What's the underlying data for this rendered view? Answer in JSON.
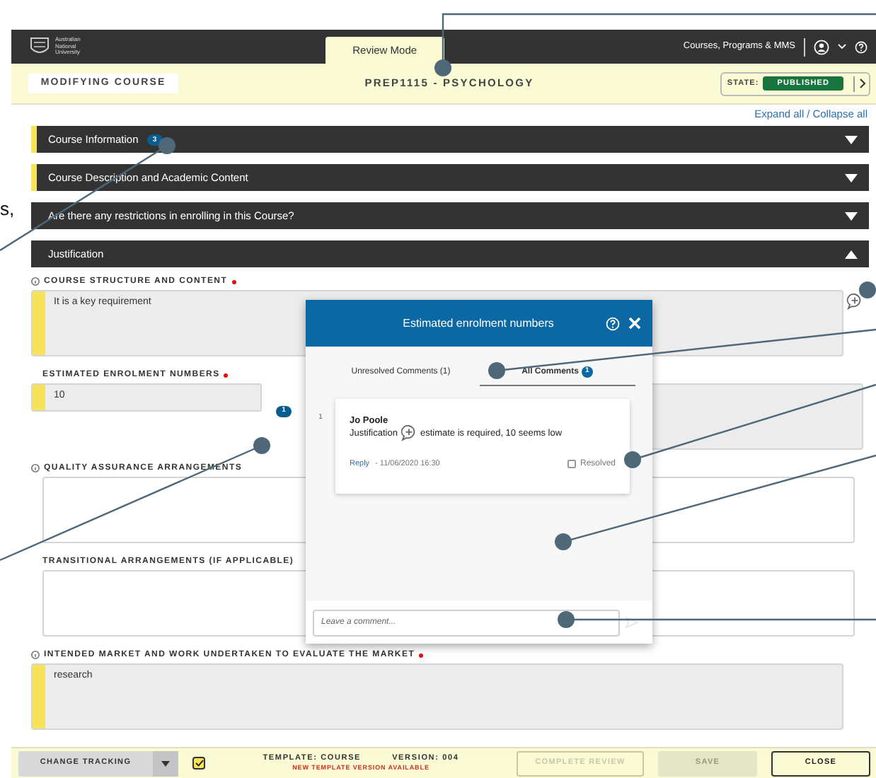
{
  "app": {
    "logo_lines": [
      "Australian",
      "National",
      "University"
    ],
    "mode_tab": "Review Mode",
    "nav_link": "Courses, Programs & MMS"
  },
  "header": {
    "title": "MODIFYING COURSE",
    "course": "PREP1115 - PSYCHOLOGY",
    "state_label": "STATE:",
    "state": "PUBLISHED"
  },
  "expand_all": "Expand all",
  "separator": "/",
  "collapse_all": "Collapse all",
  "sections": [
    {
      "title": "Course Information",
      "badge": "3",
      "flagged": true,
      "expanded": false
    },
    {
      "title": "Course Description and Academic Content",
      "flagged": true,
      "expanded": false
    },
    {
      "title": "Are there any restrictions in enrolling in this Course?",
      "flagged": false,
      "expanded": false
    },
    {
      "title": "Justification",
      "flagged": false,
      "expanded": true
    }
  ],
  "fields": [
    {
      "kind": "textarea",
      "label": "COURSE STRUCTURE AND CONTENT",
      "info": true,
      "required": true,
      "flagged": true,
      "value": "It is a key requirement"
    },
    {
      "kind": "input",
      "label": "ESTIMATED ENROLMENT NUMBERS",
      "info": false,
      "required": true,
      "flagged": true,
      "value": "10",
      "comment_count": "1"
    },
    {
      "kind": "textarea",
      "label": "QUALITY ASSURANCE ARRANGEMENTS",
      "info": true,
      "required": false,
      "flagged": false
    },
    {
      "kind": "textarea",
      "label": "TRANSITIONAL ARRANGEMENTS (IF APPLICABLE)",
      "info": false,
      "required": false,
      "flagged": false
    },
    {
      "kind": "textarea",
      "label": "INTENDED MARKET AND WORK UNDERTAKEN TO EVALUATE THE MARKET",
      "info": true,
      "required": true,
      "flagged": true,
      "value": "research"
    }
  ],
  "comment_panel": {
    "title": "Estimated enrolment numbers",
    "tabs": [
      {
        "label": "Unresolved Comments (1)",
        "selected": false
      },
      {
        "label": "All Comments",
        "badge": "1",
        "selected": true
      }
    ],
    "comments": [
      {
        "number": "1",
        "author": "Jo Poole",
        "text_start": "Justification",
        "text_end": "estimate is required, 10 seems low",
        "reply": "Reply",
        "timestamp": "- 11/06/2020 16:30",
        "resolved_label": "Resolved",
        "resolved": false
      }
    ],
    "input": {
      "placeholder": "Leave a comment..."
    }
  },
  "footer": {
    "tracking": "CHANGE TRACKING",
    "tracking_checked": true,
    "template": "TEMPLATE: COURSE",
    "version": "VERSION: 004",
    "notice": "NEW TEMPLATE VERSION AVAILABLE",
    "buttons": [
      {
        "kind": "outline",
        "label": "COMPLETE REVIEW",
        "disabled": true
      },
      {
        "kind": "filled",
        "label": "SAVE",
        "disabled": true
      },
      {
        "kind": "outline",
        "label": "CLOSE",
        "disabled": false
      }
    ]
  },
  "annotation_fragment": "s,"
}
